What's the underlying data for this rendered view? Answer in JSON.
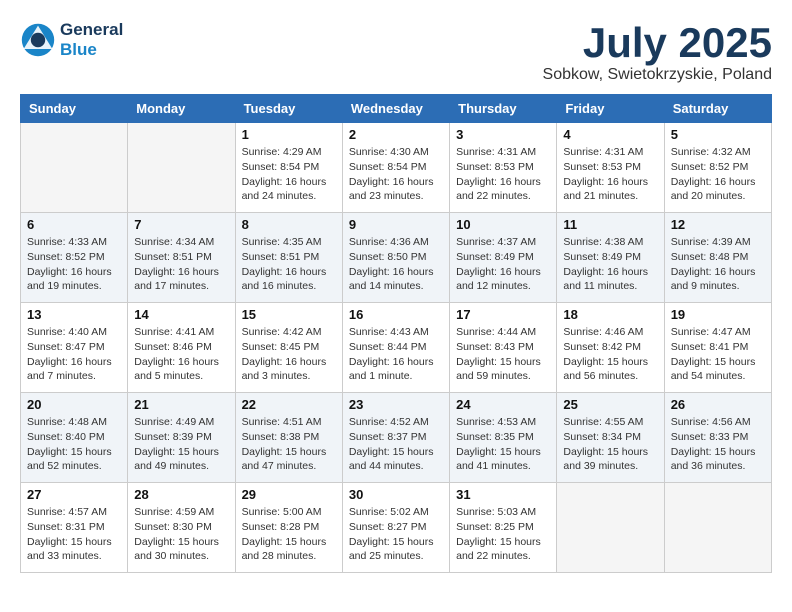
{
  "header": {
    "logo_line1": "General",
    "logo_line2": "Blue",
    "month_title": "July 2025",
    "location": "Sobkow, Swietokrzyskie, Poland"
  },
  "weekdays": [
    "Sunday",
    "Monday",
    "Tuesday",
    "Wednesday",
    "Thursday",
    "Friday",
    "Saturday"
  ],
  "weeks": [
    [
      {
        "day": "",
        "info": ""
      },
      {
        "day": "",
        "info": ""
      },
      {
        "day": "1",
        "info": "Sunrise: 4:29 AM\nSunset: 8:54 PM\nDaylight: 16 hours\nand 24 minutes."
      },
      {
        "day": "2",
        "info": "Sunrise: 4:30 AM\nSunset: 8:54 PM\nDaylight: 16 hours\nand 23 minutes."
      },
      {
        "day": "3",
        "info": "Sunrise: 4:31 AM\nSunset: 8:53 PM\nDaylight: 16 hours\nand 22 minutes."
      },
      {
        "day": "4",
        "info": "Sunrise: 4:31 AM\nSunset: 8:53 PM\nDaylight: 16 hours\nand 21 minutes."
      },
      {
        "day": "5",
        "info": "Sunrise: 4:32 AM\nSunset: 8:52 PM\nDaylight: 16 hours\nand 20 minutes."
      }
    ],
    [
      {
        "day": "6",
        "info": "Sunrise: 4:33 AM\nSunset: 8:52 PM\nDaylight: 16 hours\nand 19 minutes."
      },
      {
        "day": "7",
        "info": "Sunrise: 4:34 AM\nSunset: 8:51 PM\nDaylight: 16 hours\nand 17 minutes."
      },
      {
        "day": "8",
        "info": "Sunrise: 4:35 AM\nSunset: 8:51 PM\nDaylight: 16 hours\nand 16 minutes."
      },
      {
        "day": "9",
        "info": "Sunrise: 4:36 AM\nSunset: 8:50 PM\nDaylight: 16 hours\nand 14 minutes."
      },
      {
        "day": "10",
        "info": "Sunrise: 4:37 AM\nSunset: 8:49 PM\nDaylight: 16 hours\nand 12 minutes."
      },
      {
        "day": "11",
        "info": "Sunrise: 4:38 AM\nSunset: 8:49 PM\nDaylight: 16 hours\nand 11 minutes."
      },
      {
        "day": "12",
        "info": "Sunrise: 4:39 AM\nSunset: 8:48 PM\nDaylight: 16 hours\nand 9 minutes."
      }
    ],
    [
      {
        "day": "13",
        "info": "Sunrise: 4:40 AM\nSunset: 8:47 PM\nDaylight: 16 hours\nand 7 minutes."
      },
      {
        "day": "14",
        "info": "Sunrise: 4:41 AM\nSunset: 8:46 PM\nDaylight: 16 hours\nand 5 minutes."
      },
      {
        "day": "15",
        "info": "Sunrise: 4:42 AM\nSunset: 8:45 PM\nDaylight: 16 hours\nand 3 minutes."
      },
      {
        "day": "16",
        "info": "Sunrise: 4:43 AM\nSunset: 8:44 PM\nDaylight: 16 hours\nand 1 minute."
      },
      {
        "day": "17",
        "info": "Sunrise: 4:44 AM\nSunset: 8:43 PM\nDaylight: 15 hours\nand 59 minutes."
      },
      {
        "day": "18",
        "info": "Sunrise: 4:46 AM\nSunset: 8:42 PM\nDaylight: 15 hours\nand 56 minutes."
      },
      {
        "day": "19",
        "info": "Sunrise: 4:47 AM\nSunset: 8:41 PM\nDaylight: 15 hours\nand 54 minutes."
      }
    ],
    [
      {
        "day": "20",
        "info": "Sunrise: 4:48 AM\nSunset: 8:40 PM\nDaylight: 15 hours\nand 52 minutes."
      },
      {
        "day": "21",
        "info": "Sunrise: 4:49 AM\nSunset: 8:39 PM\nDaylight: 15 hours\nand 49 minutes."
      },
      {
        "day": "22",
        "info": "Sunrise: 4:51 AM\nSunset: 8:38 PM\nDaylight: 15 hours\nand 47 minutes."
      },
      {
        "day": "23",
        "info": "Sunrise: 4:52 AM\nSunset: 8:37 PM\nDaylight: 15 hours\nand 44 minutes."
      },
      {
        "day": "24",
        "info": "Sunrise: 4:53 AM\nSunset: 8:35 PM\nDaylight: 15 hours\nand 41 minutes."
      },
      {
        "day": "25",
        "info": "Sunrise: 4:55 AM\nSunset: 8:34 PM\nDaylight: 15 hours\nand 39 minutes."
      },
      {
        "day": "26",
        "info": "Sunrise: 4:56 AM\nSunset: 8:33 PM\nDaylight: 15 hours\nand 36 minutes."
      }
    ],
    [
      {
        "day": "27",
        "info": "Sunrise: 4:57 AM\nSunset: 8:31 PM\nDaylight: 15 hours\nand 33 minutes."
      },
      {
        "day": "28",
        "info": "Sunrise: 4:59 AM\nSunset: 8:30 PM\nDaylight: 15 hours\nand 30 minutes."
      },
      {
        "day": "29",
        "info": "Sunrise: 5:00 AM\nSunset: 8:28 PM\nDaylight: 15 hours\nand 28 minutes."
      },
      {
        "day": "30",
        "info": "Sunrise: 5:02 AM\nSunset: 8:27 PM\nDaylight: 15 hours\nand 25 minutes."
      },
      {
        "day": "31",
        "info": "Sunrise: 5:03 AM\nSunset: 8:25 PM\nDaylight: 15 hours\nand 22 minutes."
      },
      {
        "day": "",
        "info": ""
      },
      {
        "day": "",
        "info": ""
      }
    ]
  ]
}
